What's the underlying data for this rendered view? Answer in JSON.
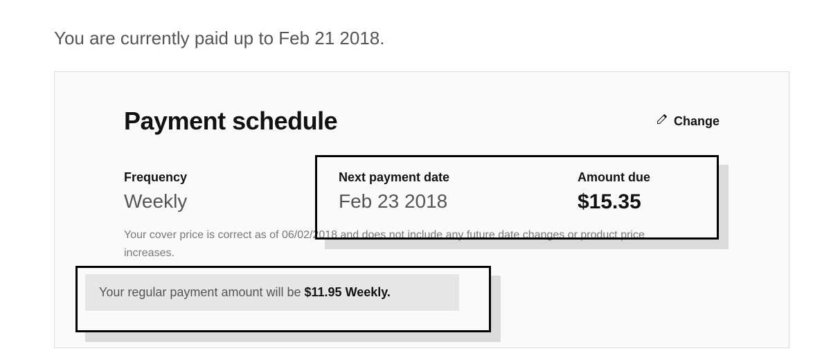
{
  "paid_up_text": "You are currently paid up to Feb 21 2018.",
  "panel": {
    "title": "Payment schedule",
    "change_label": "Change",
    "frequency_label": "Frequency",
    "frequency_value": "Weekly",
    "next_payment_label": "Next payment date",
    "next_payment_value": "Feb 23 2018",
    "amount_due_label": "Amount due",
    "amount_due_value": "$15.35",
    "fineprint": "Your cover price is correct as of 06/02/2018 and does not include any future date changes or product price increases.",
    "regular_prefix": "Your regular payment amount will be ",
    "regular_amount": "$11.95 Weekly."
  }
}
